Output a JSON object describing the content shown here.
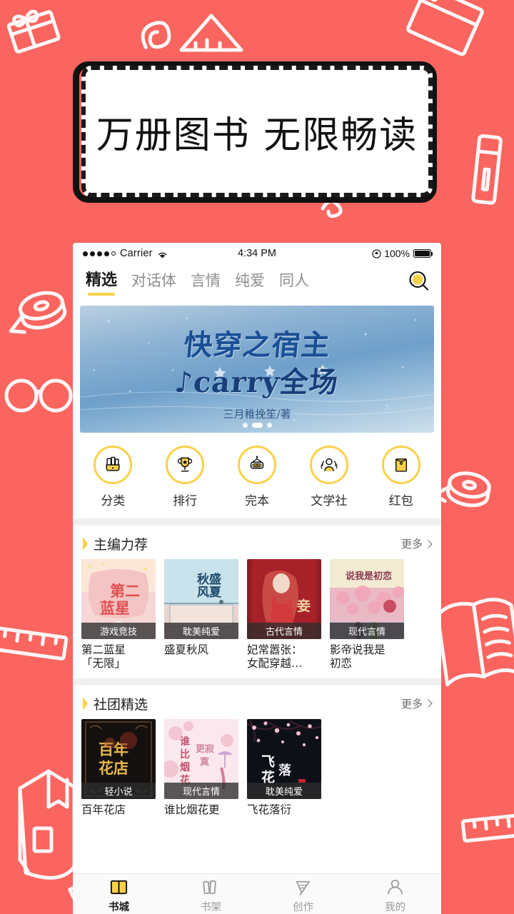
{
  "promo": {
    "headline": "万册图书  无限畅读"
  },
  "theme": {
    "background": "#fa6560",
    "accent_yellow": "#fbd14a",
    "ink": "#1a1a1a"
  },
  "statusbar": {
    "carrier": "Carrier",
    "time": "4:34 PM",
    "battery_percent": "100%",
    "signal_dots_filled": 4,
    "signal_dots_total": 5
  },
  "navbar": {
    "tabs": [
      {
        "label": "精选",
        "active": true
      },
      {
        "label": "对话体",
        "active": false
      },
      {
        "label": "言情",
        "active": false
      },
      {
        "label": "纯爱",
        "active": false
      },
      {
        "label": "同人",
        "active": false
      }
    ],
    "search_icon": "search-icon"
  },
  "banner": {
    "title_line1": "快穿之宿主",
    "title_line2": "♪carry全场",
    "author": "三月稚挽笙/著",
    "dot_count": 3,
    "active_dot_index": 1
  },
  "quick_actions": [
    {
      "label": "分类",
      "icon": "books-basket-icon"
    },
    {
      "label": "排行",
      "icon": "trophy-icon"
    },
    {
      "label": "完本",
      "icon": "end-sign-icon"
    },
    {
      "label": "文学社",
      "icon": "people-group-icon"
    },
    {
      "label": "红包",
      "icon": "red-envelope-icon"
    }
  ],
  "sections": [
    {
      "title": "主编力荐",
      "more_label": "更多",
      "books": [
        {
          "title": "第二蓝星\n「无限」",
          "badge": "游戏竞技",
          "cover": "pink"
        },
        {
          "title": "盛夏秋风",
          "badge": "耽美纯爱",
          "cover": "blue"
        },
        {
          "title": "妃常嚣张：\n女配穿越…",
          "badge": "古代言情",
          "cover": "red"
        },
        {
          "title": "影帝说我是\n初恋",
          "badge": "现代言情",
          "cover": "cream"
        }
      ]
    },
    {
      "title": "社团精选",
      "more_label": "更多",
      "books": [
        {
          "title": "百年花店",
          "badge": "轻小说",
          "cover": "dark"
        },
        {
          "title": "谁比烟花更",
          "badge": "现代言情",
          "cover": "lightpink"
        },
        {
          "title": "飞花落衍",
          "badge": "耽美纯爱",
          "cover": "night"
        }
      ]
    }
  ],
  "tabbar": [
    {
      "label": "书城",
      "icon": "open-book-icon",
      "active": true
    },
    {
      "label": "书架",
      "icon": "bookshelf-icon",
      "active": false
    },
    {
      "label": "创作",
      "icon": "pen-nib-icon",
      "active": false
    },
    {
      "label": "我的",
      "icon": "person-icon",
      "active": false
    }
  ]
}
